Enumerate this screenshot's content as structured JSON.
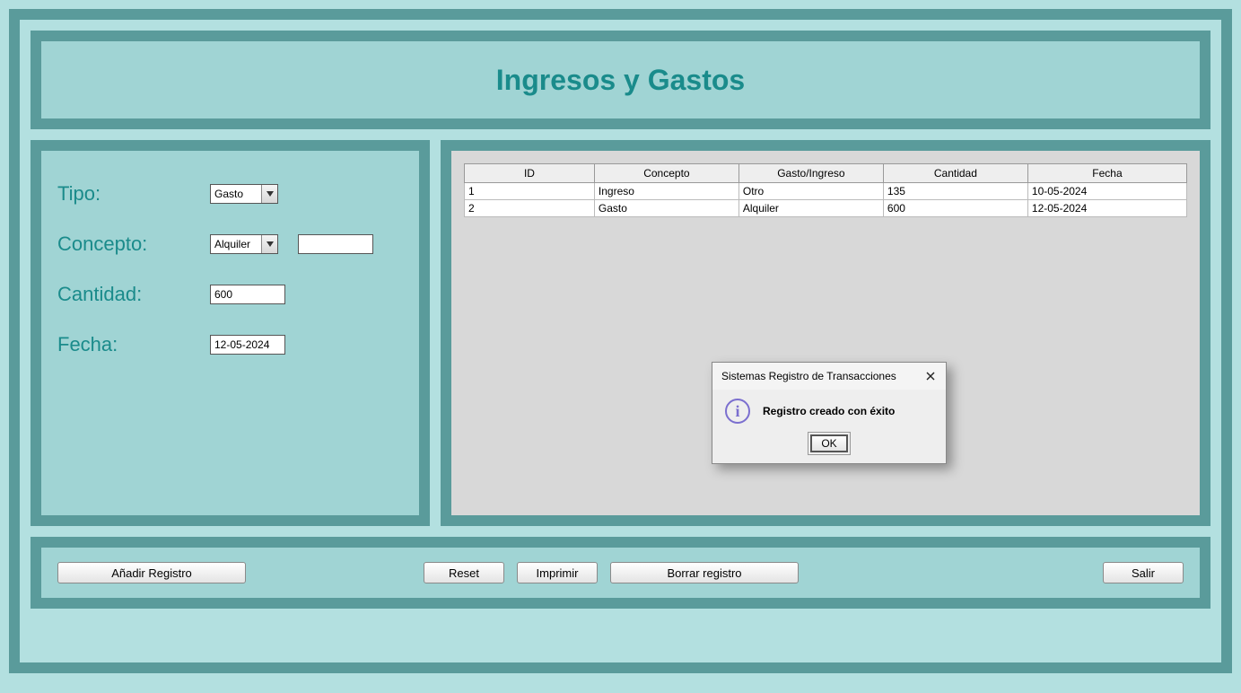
{
  "header": {
    "title": "Ingresos y Gastos"
  },
  "form": {
    "tipo_label": "Tipo:",
    "tipo_value": "Gasto",
    "concepto_label": "Concepto:",
    "concepto_value": "Alquiler",
    "concepto_extra_value": "",
    "cantidad_label": "Cantidad:",
    "cantidad_value": "600",
    "fecha_label": "Fecha:",
    "fecha_value": "12-05-2024"
  },
  "table": {
    "headers": [
      "ID",
      "Concepto",
      "Gasto/Ingreso",
      "Cantidad",
      "Fecha"
    ],
    "rows": [
      {
        "id": "1",
        "concepto": "Ingreso",
        "gi": "Otro",
        "cantidad": "135",
        "fecha": "10-05-2024"
      },
      {
        "id": "2",
        "concepto": "Gasto",
        "gi": "Alquiler",
        "cantidad": "600",
        "fecha": "12-05-2024"
      }
    ]
  },
  "buttons": {
    "anadir": "Añadir Registro",
    "reset": "Reset",
    "imprimir": "Imprimir",
    "borrar": "Borrar registro",
    "salir": "Salir"
  },
  "dialog": {
    "title": "Sistemas Registro de Transacciones",
    "message": "Registro creado con éxito",
    "ok": "OK"
  }
}
